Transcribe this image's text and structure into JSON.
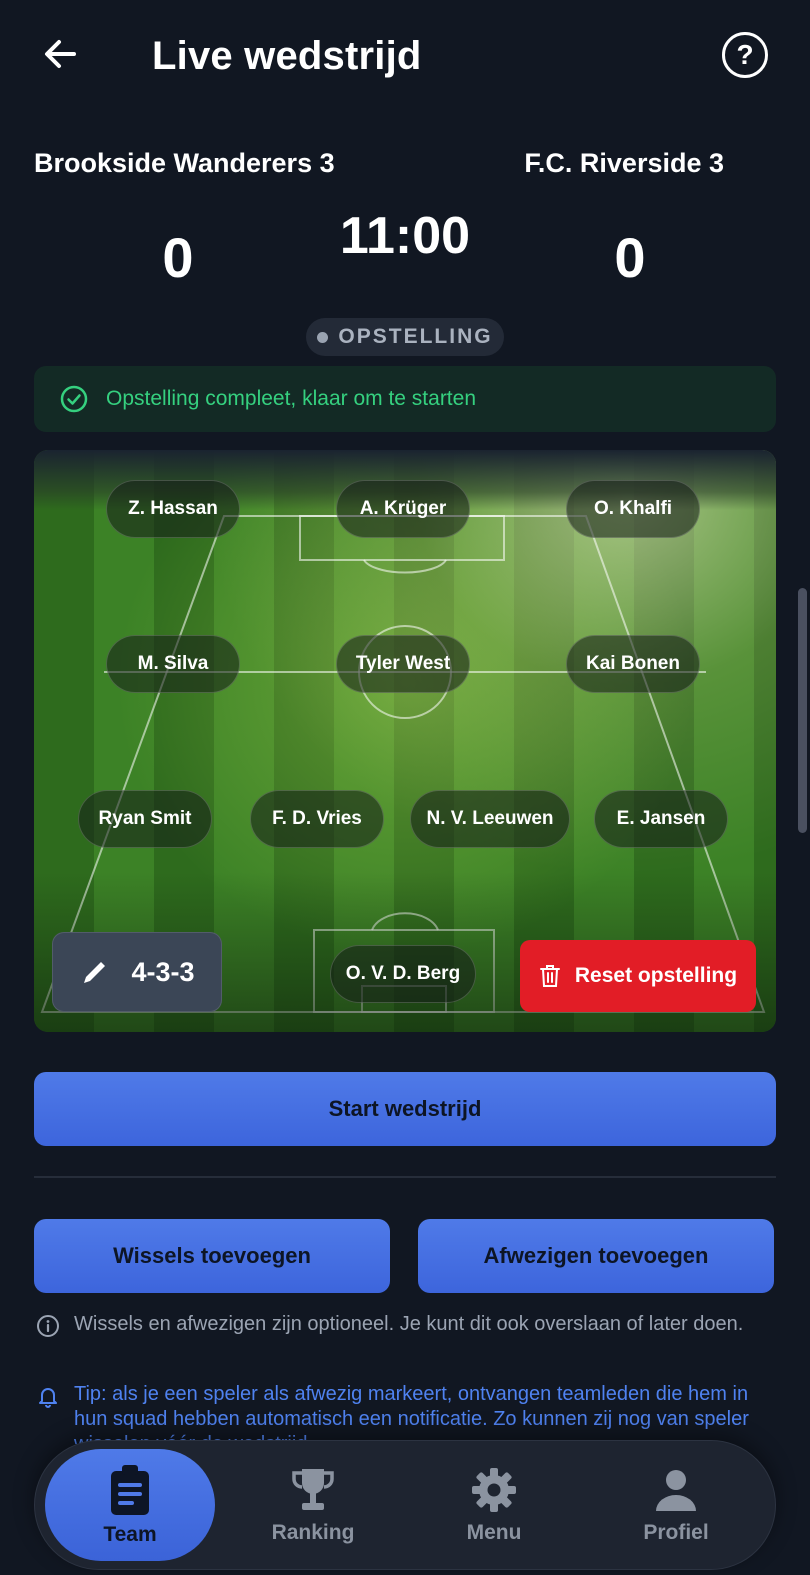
{
  "header": {
    "title": "Live wedstrijd"
  },
  "match": {
    "home_team": "Brookside Wanderers 3",
    "away_team": "F.C. Riverside 3",
    "home_score": "0",
    "away_score": "0",
    "clock": "11:00",
    "phase": "OPSTELLING"
  },
  "status": {
    "message": "Opstelling compleet, klaar om te starten"
  },
  "lineup": {
    "formation": "4-3-3",
    "reset_label": "Reset opstelling",
    "players": [
      "Z. Hassan",
      "A. Krüger",
      "O. Khalfi",
      "M. Silva",
      "Tyler West",
      "Kai Bonen",
      "Ryan Smit",
      "F. D. Vries",
      "N. V. Leeuwen",
      "E. Jansen",
      "O. V. D. Berg"
    ]
  },
  "actions": {
    "start": "Start wedstrijd",
    "add_subs": "Wissels toevoegen",
    "add_absent": "Afwezigen toevoegen"
  },
  "info": {
    "optional_note": "Wissels en afwezigen zijn optioneel. Je kunt dit ook overslaan of later doen.",
    "tip": "Tip: als je een speler als afwezig markeert, ontvangen teamleden die hem in hun squad hebben automatisch een notificatie. Zo kunnen zij nog van speler wisselen vóór de wedstrijd."
  },
  "nav": {
    "items": [
      {
        "label": "Team",
        "icon": "clipboard-icon",
        "active": true
      },
      {
        "label": "Ranking",
        "icon": "trophy-icon",
        "active": false
      },
      {
        "label": "Menu",
        "icon": "gear-icon",
        "active": false
      },
      {
        "label": "Profiel",
        "icon": "person-icon",
        "active": false
      }
    ]
  },
  "colors": {
    "background": "#111722",
    "accent": "#4f7ae8",
    "success": "#35d07f",
    "danger": "#e21d26",
    "info_link": "#4f82f0"
  }
}
